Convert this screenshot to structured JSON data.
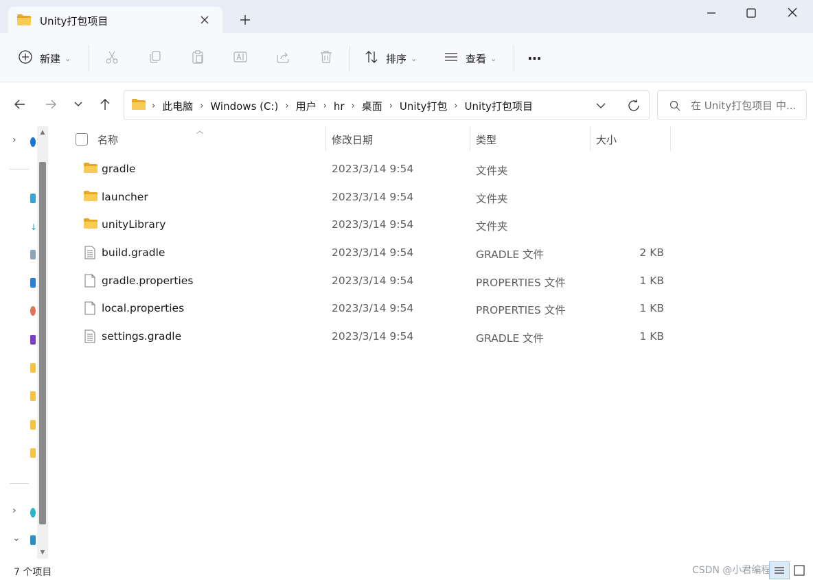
{
  "window": {
    "tab_title": "Unity打包项目",
    "colors": {
      "titlebar": "#e9eef6",
      "folder": "#f6c342",
      "accent": "#0067c0"
    }
  },
  "toolbar": {
    "new_label": "新建",
    "sort_label": "排序",
    "view_label": "查看",
    "more_label": "···"
  },
  "address": {
    "crumbs": [
      "此电脑",
      "Windows (C:)",
      "用户",
      "hr",
      "桌面",
      "Unity打包",
      "Unity打包项目"
    ]
  },
  "search": {
    "placeholder": "在 Unity打包项目 中..."
  },
  "columns": {
    "name": "名称",
    "date": "修改日期",
    "type": "类型",
    "size": "大小"
  },
  "files": [
    {
      "icon": "folder-icon",
      "name": "gradle",
      "date": "2023/3/14 9:54",
      "type": "文件夹",
      "size": ""
    },
    {
      "icon": "folder-icon",
      "name": "launcher",
      "date": "2023/3/14 9:54",
      "type": "文件夹",
      "size": ""
    },
    {
      "icon": "folder-icon",
      "name": "unityLibrary",
      "date": "2023/3/14 9:54",
      "type": "文件夹",
      "size": ""
    },
    {
      "icon": "text-file-icon",
      "name": "build.gradle",
      "date": "2023/3/14 9:54",
      "type": "GRADLE 文件",
      "size": "2 KB"
    },
    {
      "icon": "blank-file-icon",
      "name": "gradle.properties",
      "date": "2023/3/14 9:54",
      "type": "PROPERTIES 文件",
      "size": "1 KB"
    },
    {
      "icon": "blank-file-icon",
      "name": "local.properties",
      "date": "2023/3/14 9:54",
      "type": "PROPERTIES 文件",
      "size": "1 KB"
    },
    {
      "icon": "text-file-icon",
      "name": "settings.gradle",
      "date": "2023/3/14 9:54",
      "type": "GRADLE 文件",
      "size": "1 KB"
    }
  ],
  "status": {
    "item_count": "7 个项目",
    "watermark": "CSDN @小君编程"
  }
}
